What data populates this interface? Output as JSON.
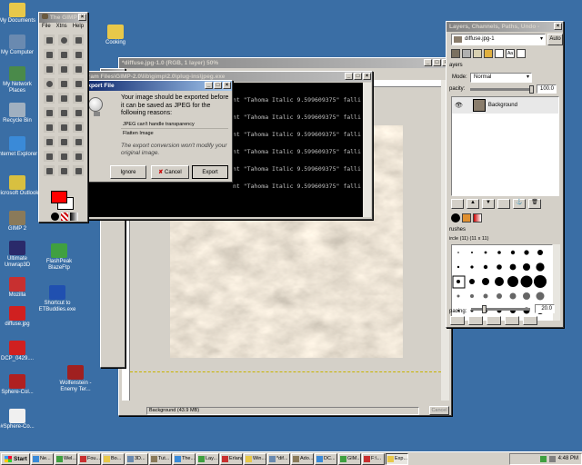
{
  "desktop_icons": [
    {
      "label": "My Documents",
      "icon": "folder-icon",
      "color": "#e8c84a"
    },
    {
      "label": "My Computer",
      "icon": "computer-icon",
      "color": "#6a8ab0"
    },
    {
      "label": "My Network Places",
      "icon": "network-icon",
      "color": "#4a8a4a"
    },
    {
      "label": "Recycle Bin",
      "icon": "recycle-bin-icon",
      "color": "#a0b0c0"
    },
    {
      "label": "Internet Explorer",
      "icon": "ie-icon",
      "color": "#3a8ad8"
    },
    {
      "label": "Microsoft Outlook",
      "icon": "outlook-icon",
      "color": "#d8c040"
    },
    {
      "label": "GIMP 2",
      "icon": "gimp-icon",
      "color": "#8a7a5a"
    },
    {
      "label": "Ultimate Unwrap3D",
      "icon": "unwrap-icon",
      "color": "#2a2a6a"
    },
    {
      "label": "Mozilla",
      "icon": "mozilla-icon",
      "color": "#c83030"
    },
    {
      "label": "diffuse.jpg",
      "icon": "image-file-icon",
      "color": "#d02020"
    },
    {
      "label": "DCP_0429....",
      "icon": "image-file-icon",
      "color": "#d02020"
    },
    {
      "label": "Sphere-Col...",
      "icon": "sphere-icon",
      "color": "#b02020"
    },
    {
      "label": "#Sphere-Co...",
      "icon": "file-icon",
      "color": "#f0f0f0"
    },
    {
      "label": "Cooking",
      "icon": "folder-icon",
      "color": "#e8c84a"
    },
    {
      "label": "FlashPeak BlazeFtp",
      "icon": "ftp-icon",
      "color": "#40a040"
    },
    {
      "label": "Shortcut to ETBuddies.exe",
      "icon": "shortcut-icon",
      "color": "#2050b0"
    },
    {
      "label": "Wolfenstein - Enemy Ter...",
      "icon": "game-icon",
      "color": "#a02020"
    }
  ],
  "toolbox": {
    "title": "The GIMP",
    "menu": [
      "File",
      "Xtns",
      "Help"
    ],
    "fg_color": "#ff0000",
    "bg_color": "#ffffff"
  },
  "image_window": {
    "title": "*diffuse.jpg-1.0 (RGB, 1 layer) 50%",
    "status": "Background (43.9 MB)",
    "cancel": "Cancel",
    "texture_color": "#8a7d6c"
  },
  "console": {
    "title": "Program Files\\GIMP-2.0\\lib\\gimp\\2.0\\plug-ins\\jpeg.exe",
    "lines": [
      "nt \"Tahoma Italic 9.599609375\" falli",
      "nt \"Tahoma Italic 9.599609375\" falli",
      "nt \"Tahoma Italic 9.599609375\" falli",
      "nt \"Tahoma Italic 9.599609375\" falli",
      "nt \"Tahoma Italic 9.599609375\" falli",
      "nt \"Tahoma Italic 9.599609375\" falli"
    ]
  },
  "export_dialog": {
    "title": "Export File",
    "heading": "Your image should be exported before it can be saved as JPEG for the following reasons:",
    "reasons": [
      "JPEG can't handle transparency",
      "Flatten Image"
    ],
    "note": "The export conversion won't modify your original image.",
    "ignore": "Ignore",
    "cancel": "Cancel",
    "export": "Export"
  },
  "layers_dialog": {
    "title": "Layers, Channels, Paths, Undo -",
    "image_select": "diffuse.jpg-1",
    "auto": "Auto",
    "tab_label": "ayers",
    "mode_label": "Mode:",
    "mode_value": "Normal",
    "opacity_label": "pacity:",
    "opacity_value": "100.0",
    "opacity_fraction": 1.0,
    "layer_name": "Background",
    "brushes_label": "rushes",
    "brush_name": "ircle (11) (11 x 11)",
    "spacing_label": "pacing:",
    "spacing_value": "20.0",
    "spacing_fraction": 0.2
  },
  "taskbar": {
    "start": "Start",
    "tasks": [
      "Ne...",
      "Wel...",
      "Fou...",
      "Bo...",
      "3D...",
      "Tut...",
      "The...",
      "Lay...",
      "Erlang",
      "Win...",
      "*dif...",
      "Ado...",
      "DC...",
      "GIM...",
      "F:\\...",
      "Exp..."
    ],
    "active_index": 15,
    "clock": "4:48 PM"
  }
}
